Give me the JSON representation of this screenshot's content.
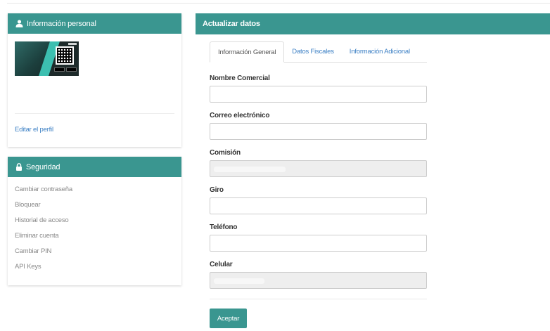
{
  "personal": {
    "title": "Información personal",
    "icon": "user-icon",
    "edit_link": "Editar el perfil"
  },
  "security": {
    "title": "Seguridad",
    "icon": "lock-icon",
    "items": [
      {
        "label": "Cambiar contraseña"
      },
      {
        "label": "Bloquear"
      },
      {
        "label": "Historial de acceso"
      },
      {
        "label": "Eliminar cuenta"
      },
      {
        "label": "Cambiar PIN"
      },
      {
        "label": "API Keys"
      }
    ]
  },
  "update": {
    "title": "Actualizar datos",
    "tabs": [
      {
        "label": "Información General",
        "active": true
      },
      {
        "label": "Datos Fiscales",
        "active": false
      },
      {
        "label": "Información Adicional",
        "active": false
      }
    ],
    "fields": {
      "nombre_comercial": {
        "label": "Nombre Comercial",
        "value": ""
      },
      "correo": {
        "label": "Correo electrónico",
        "value": ""
      },
      "comision": {
        "label": "Comisión",
        "value": "",
        "disabled": true
      },
      "giro": {
        "label": "Giro",
        "value": ""
      },
      "telefono": {
        "label": "Teléfono",
        "value": ""
      },
      "celular": {
        "label": "Celular",
        "value": "",
        "disabled": true
      }
    },
    "submit_label": "Aceptar"
  },
  "colors": {
    "accent": "#3a9690",
    "link": "#3b7fc4"
  }
}
